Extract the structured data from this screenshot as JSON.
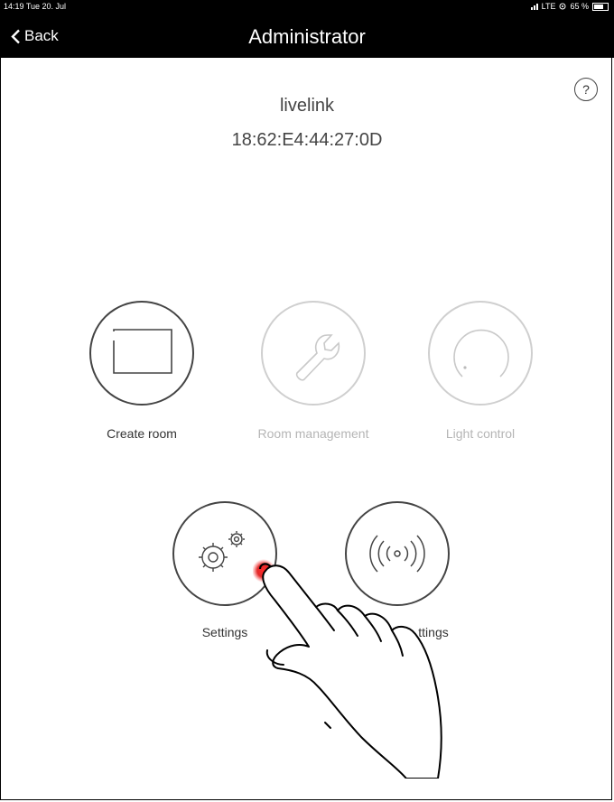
{
  "statusbar": {
    "time_date": "14:19 Tue 20. Jul",
    "network": "LTE",
    "battery": "65 %"
  },
  "navbar": {
    "back_label": "Back",
    "title": "Administrator"
  },
  "help": {
    "label": "?"
  },
  "device": {
    "name": "livelink",
    "mac": "18:62:E4:44:27:0D"
  },
  "tiles": {
    "create_room": {
      "label": "Create room"
    },
    "room_management": {
      "label": "Room management"
    },
    "light_control": {
      "label": "Light control"
    },
    "settings": {
      "label": "Settings"
    },
    "radio_settings": {
      "label": "ttings"
    }
  }
}
